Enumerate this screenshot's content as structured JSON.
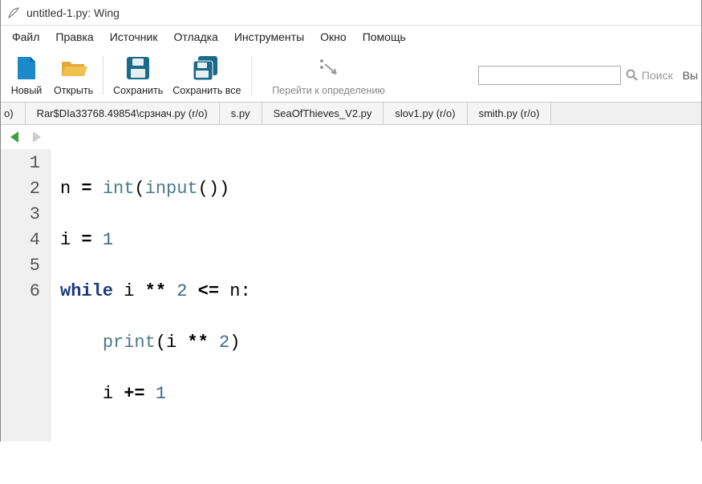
{
  "window": {
    "title": "untitled-1.py: Wing"
  },
  "menu": {
    "file": "Файл",
    "edit": "Правка",
    "source": "Источник",
    "debug": "Отладка",
    "tools": "Инструменты",
    "window": "Окно",
    "help": "Помощь"
  },
  "toolbar": {
    "new": "Новый",
    "open": "Открыть",
    "save": "Сохранить",
    "save_all": "Сохранить все",
    "goto_def": "Перейти к определению",
    "search_placeholder": "",
    "search_label": "Поиск",
    "truncated_right": "Вы"
  },
  "tabs": {
    "t0": "o)",
    "t1": "Rar$DIa33768.49854\\срзнач.py (r/o)",
    "t2": "s.py",
    "t3": "SeaOfThieves_V2.py",
    "t4": "slov1.py (r/o)",
    "t5": "smith.py (r/o)"
  },
  "code": {
    "lines": [
      "1",
      "2",
      "3",
      "4",
      "5",
      "6"
    ],
    "l1": {
      "var_n": "n",
      "eq": " = ",
      "int": "int",
      "lp1": "(",
      "input": "input",
      "lp2": "(",
      "rp2": ")",
      "rp1": ")"
    },
    "l2": {
      "var_i": "i",
      "eq": " = ",
      "one": "1"
    },
    "l3": {
      "while": "while",
      "sp": " ",
      "i": "i",
      "pow": " ** ",
      "two": "2",
      "le": " <= ",
      "n": "n",
      "colon": ":"
    },
    "l4": {
      "indent": "    ",
      "print": "print",
      "lp": "(",
      "i": "i",
      "pow": " ** ",
      "two": "2",
      "rp": ")"
    },
    "l5": {
      "indent": "    ",
      "i": "i",
      "pluseq": " += ",
      "one": "1"
    }
  }
}
